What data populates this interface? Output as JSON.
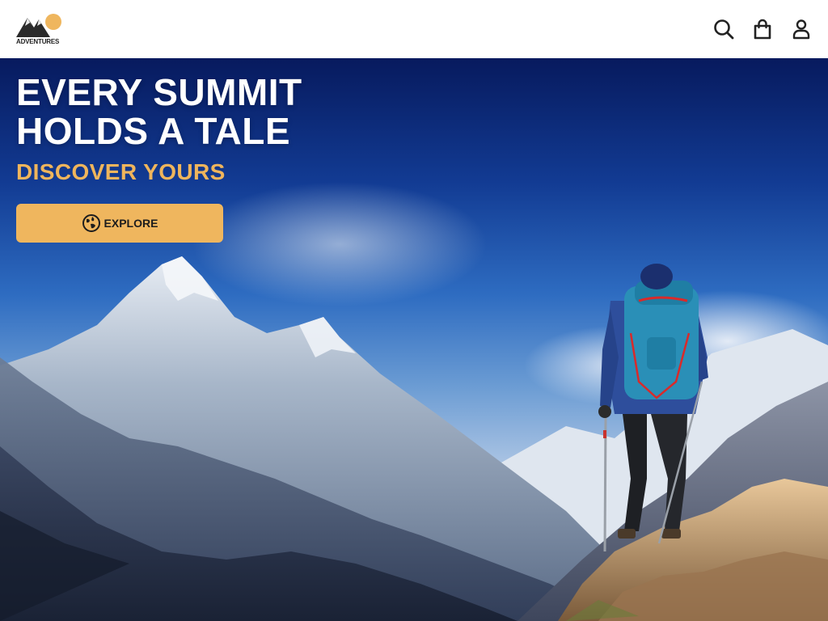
{
  "header": {
    "logo_text": "ADVENTURES",
    "icons": [
      "search-icon",
      "shopping-bag-icon",
      "user-icon"
    ]
  },
  "hero": {
    "headline_line1": "EVERY SUMMIT",
    "headline_line2": "HOLDS A TALE",
    "subheadline": "DISCOVER YOURS",
    "cta_label": "EXPLORE",
    "cta_icon": "compass-globe-icon"
  },
  "colors": {
    "accent": "#efb65e",
    "header_bg": "#ffffff",
    "headline": "#ffffff"
  }
}
